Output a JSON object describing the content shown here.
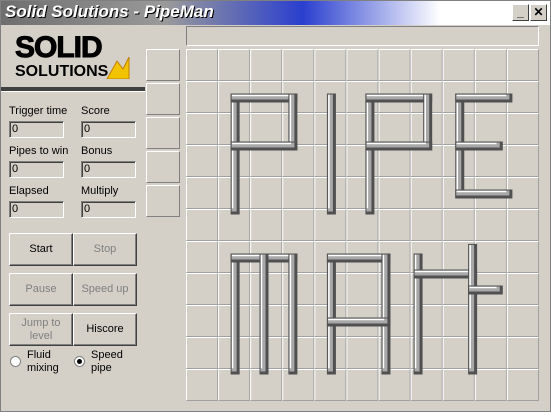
{
  "window": {
    "title": "Solid Solutions - PipeMan"
  },
  "logo": {
    "line1": "SOLID",
    "line2": "SOLUTIONS"
  },
  "stats": {
    "trigger_time": {
      "label": "Trigger time",
      "value": "0"
    },
    "score": {
      "label": "Score",
      "value": "0"
    },
    "pipes_to_win": {
      "label": "Pipes to win",
      "value": "0"
    },
    "bonus": {
      "label": "Bonus",
      "value": "0"
    },
    "elapsed": {
      "label": "Elapsed",
      "value": "0"
    },
    "multiply": {
      "label": "Multiply",
      "value": "0"
    }
  },
  "buttons": {
    "start": "Start",
    "stop": "Stop",
    "pause": "Pause",
    "speed_up": "Speed up",
    "jump_to_level": "Jump to level",
    "hiscore": "Hiscore"
  },
  "radios": {
    "fluid_mixing": {
      "label": "Fluid mixing",
      "selected": false
    },
    "speed_pipe": {
      "label": "Speed pipe",
      "selected": true
    }
  },
  "progress": {
    "fraction": 0
  },
  "board": {
    "cols": 11,
    "rows": 11,
    "banner_words": [
      "PIPE",
      "MAN"
    ]
  },
  "queue": {
    "slots": 5
  },
  "colors": {
    "accent": "#2a3fcf",
    "face": "#d4d0c8",
    "flame": "#f2c300"
  },
  "icons": {
    "minimize": "minimize-icon",
    "close": "close-icon"
  }
}
